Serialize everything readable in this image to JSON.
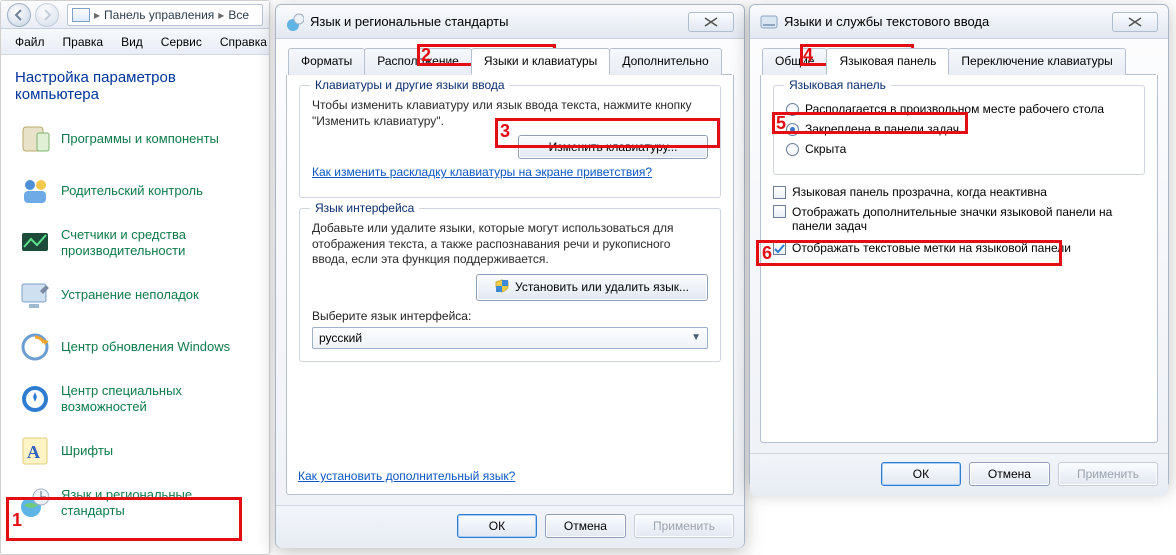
{
  "cp": {
    "breadcrumb": {
      "seg1": "Панель управления",
      "seg2": "Все"
    },
    "menu": [
      "Файл",
      "Правка",
      "Вид",
      "Сервис",
      "Справка"
    ],
    "heading": "Настройка параметров компьютера",
    "items": [
      "Программы и компоненты",
      "Родительский контроль",
      "Счетчики и средства производительности",
      "Устранение неполадок",
      "Центр обновления Windows",
      "Центр специальных возможностей",
      "Шрифты",
      "Язык и региональные стандарты"
    ]
  },
  "dlg1": {
    "title": "Язык и региональные стандарты",
    "tabs": [
      "Форматы",
      "Расположение",
      "Языки и клавиатуры",
      "Дополнительно"
    ],
    "group1": {
      "legend": "Клавиатуры и другие языки ввода",
      "desc": "Чтобы изменить клавиатуру или язык ввода текста, нажмите кнопку \"Изменить клавиатуру\".",
      "btn": "Изменить клавиатуру...",
      "link": "Как изменить раскладку клавиатуры на экране приветствия?"
    },
    "group2": {
      "legend": "Язык интерфейса",
      "desc": "Добавьте или удалите языки, которые могут использоваться для отображения текста, а также распознавания речи и рукописного ввода, если эта функция поддерживается.",
      "btn": "Установить или удалить язык...",
      "select_label": "Выберите язык интерфейса:",
      "select_value": "русский"
    },
    "footer_link": "Как установить дополнительный язык?",
    "buttons": {
      "ok": "ОК",
      "cancel": "Отмена",
      "apply": "Применить"
    }
  },
  "dlg2": {
    "title": "Языки и службы текстового ввода",
    "tabs": [
      "Общие",
      "Языковая панель",
      "Переключение клавиатуры"
    ],
    "group": {
      "legend": "Языковая панель",
      "radios": [
        "Располагается в произвольном месте рабочего стола",
        "Закреплена в панели задач",
        "Скрыта"
      ],
      "checks": [
        "Языковая панель прозрачна, когда неактивна",
        "Отображать дополнительные значки языковой панели на панели задач",
        "Отображать текстовые метки на языковой панели"
      ]
    },
    "buttons": {
      "ok": "ОК",
      "cancel": "Отмена",
      "apply": "Применить"
    }
  },
  "markers": {
    "1": "1",
    "2": "2",
    "3": "3",
    "4": "4",
    "5": "5",
    "6": "6"
  }
}
